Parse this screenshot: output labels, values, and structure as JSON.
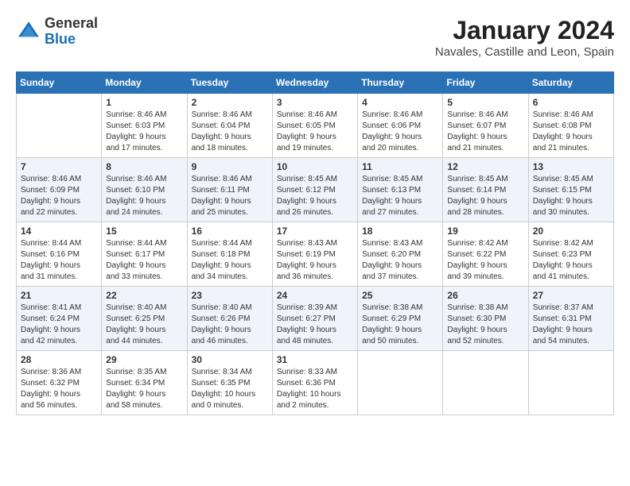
{
  "logo": {
    "general": "General",
    "blue": "Blue"
  },
  "header": {
    "month": "January 2024",
    "location": "Navales, Castille and Leon, Spain"
  },
  "days_of_week": [
    "Sunday",
    "Monday",
    "Tuesday",
    "Wednesday",
    "Thursday",
    "Friday",
    "Saturday"
  ],
  "weeks": [
    [
      {
        "day": "",
        "content": ""
      },
      {
        "day": "1",
        "content": "Sunrise: 8:46 AM\nSunset: 6:03 PM\nDaylight: 9 hours\nand 17 minutes."
      },
      {
        "day": "2",
        "content": "Sunrise: 8:46 AM\nSunset: 6:04 PM\nDaylight: 9 hours\nand 18 minutes."
      },
      {
        "day": "3",
        "content": "Sunrise: 8:46 AM\nSunset: 6:05 PM\nDaylight: 9 hours\nand 19 minutes."
      },
      {
        "day": "4",
        "content": "Sunrise: 8:46 AM\nSunset: 6:06 PM\nDaylight: 9 hours\nand 20 minutes."
      },
      {
        "day": "5",
        "content": "Sunrise: 8:46 AM\nSunset: 6:07 PM\nDaylight: 9 hours\nand 21 minutes."
      },
      {
        "day": "6",
        "content": "Sunrise: 8:46 AM\nSunset: 6:08 PM\nDaylight: 9 hours\nand 21 minutes."
      }
    ],
    [
      {
        "day": "7",
        "content": "Sunrise: 8:46 AM\nSunset: 6:09 PM\nDaylight: 9 hours\nand 22 minutes."
      },
      {
        "day": "8",
        "content": "Sunrise: 8:46 AM\nSunset: 6:10 PM\nDaylight: 9 hours\nand 24 minutes."
      },
      {
        "day": "9",
        "content": "Sunrise: 8:46 AM\nSunset: 6:11 PM\nDaylight: 9 hours\nand 25 minutes."
      },
      {
        "day": "10",
        "content": "Sunrise: 8:45 AM\nSunset: 6:12 PM\nDaylight: 9 hours\nand 26 minutes."
      },
      {
        "day": "11",
        "content": "Sunrise: 8:45 AM\nSunset: 6:13 PM\nDaylight: 9 hours\nand 27 minutes."
      },
      {
        "day": "12",
        "content": "Sunrise: 8:45 AM\nSunset: 6:14 PM\nDaylight: 9 hours\nand 28 minutes."
      },
      {
        "day": "13",
        "content": "Sunrise: 8:45 AM\nSunset: 6:15 PM\nDaylight: 9 hours\nand 30 minutes."
      }
    ],
    [
      {
        "day": "14",
        "content": "Sunrise: 8:44 AM\nSunset: 6:16 PM\nDaylight: 9 hours\nand 31 minutes."
      },
      {
        "day": "15",
        "content": "Sunrise: 8:44 AM\nSunset: 6:17 PM\nDaylight: 9 hours\nand 33 minutes."
      },
      {
        "day": "16",
        "content": "Sunrise: 8:44 AM\nSunset: 6:18 PM\nDaylight: 9 hours\nand 34 minutes."
      },
      {
        "day": "17",
        "content": "Sunrise: 8:43 AM\nSunset: 6:19 PM\nDaylight: 9 hours\nand 36 minutes."
      },
      {
        "day": "18",
        "content": "Sunrise: 8:43 AM\nSunset: 6:20 PM\nDaylight: 9 hours\nand 37 minutes."
      },
      {
        "day": "19",
        "content": "Sunrise: 8:42 AM\nSunset: 6:22 PM\nDaylight: 9 hours\nand 39 minutes."
      },
      {
        "day": "20",
        "content": "Sunrise: 8:42 AM\nSunset: 6:23 PM\nDaylight: 9 hours\nand 41 minutes."
      }
    ],
    [
      {
        "day": "21",
        "content": "Sunrise: 8:41 AM\nSunset: 6:24 PM\nDaylight: 9 hours\nand 42 minutes."
      },
      {
        "day": "22",
        "content": "Sunrise: 8:40 AM\nSunset: 6:25 PM\nDaylight: 9 hours\nand 44 minutes."
      },
      {
        "day": "23",
        "content": "Sunrise: 8:40 AM\nSunset: 6:26 PM\nDaylight: 9 hours\nand 46 minutes."
      },
      {
        "day": "24",
        "content": "Sunrise: 8:39 AM\nSunset: 6:27 PM\nDaylight: 9 hours\nand 48 minutes."
      },
      {
        "day": "25",
        "content": "Sunrise: 8:38 AM\nSunset: 6:29 PM\nDaylight: 9 hours\nand 50 minutes."
      },
      {
        "day": "26",
        "content": "Sunrise: 8:38 AM\nSunset: 6:30 PM\nDaylight: 9 hours\nand 52 minutes."
      },
      {
        "day": "27",
        "content": "Sunrise: 8:37 AM\nSunset: 6:31 PM\nDaylight: 9 hours\nand 54 minutes."
      }
    ],
    [
      {
        "day": "28",
        "content": "Sunrise: 8:36 AM\nSunset: 6:32 PM\nDaylight: 9 hours\nand 56 minutes."
      },
      {
        "day": "29",
        "content": "Sunrise: 8:35 AM\nSunset: 6:34 PM\nDaylight: 9 hours\nand 58 minutes."
      },
      {
        "day": "30",
        "content": "Sunrise: 8:34 AM\nSunset: 6:35 PM\nDaylight: 10 hours\nand 0 minutes."
      },
      {
        "day": "31",
        "content": "Sunrise: 8:33 AM\nSunset: 6:36 PM\nDaylight: 10 hours\nand 2 minutes."
      },
      {
        "day": "",
        "content": ""
      },
      {
        "day": "",
        "content": ""
      },
      {
        "day": "",
        "content": ""
      }
    ]
  ]
}
